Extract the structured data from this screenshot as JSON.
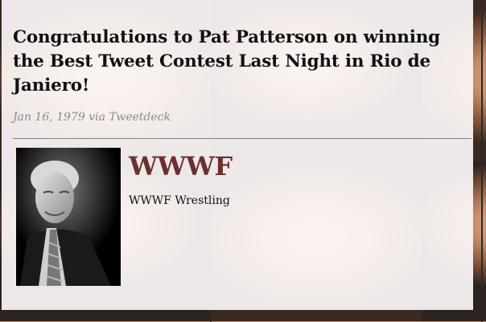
{
  "tweet": {
    "text": "Congratulations to Pat Patterson on winning the Best Tweet Contest Last Night in Rio de Janiero!",
    "meta": "Jan 16, 1979 via Tweetdeck"
  },
  "author": {
    "name": "WWWF",
    "description": "WWWF Wrestling",
    "avatar_icon": "portrait-photo"
  },
  "colors": {
    "author_name": "#6b2f2f",
    "meta_text": "#8f8a8a",
    "card_bg": "#fcf8f8"
  }
}
